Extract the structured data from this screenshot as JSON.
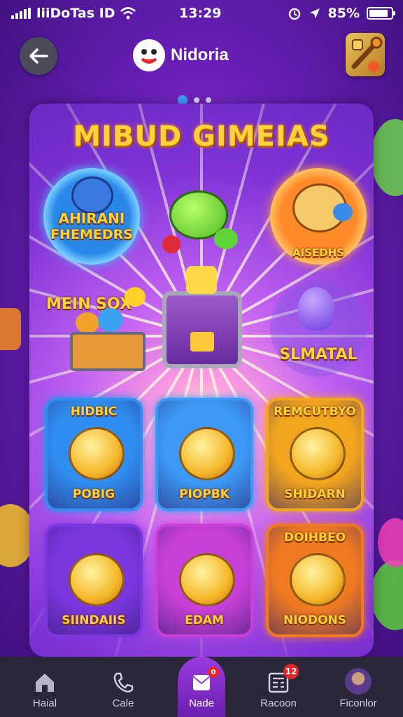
{
  "status_bar": {
    "carrier": "liiDoTas ID",
    "time": "13:29",
    "battery_percent": "85%",
    "battery_level": 0.85
  },
  "header": {
    "back_icon": "arrow-left-icon",
    "app_title": "Nidoria",
    "menu_icon": "toolbox-icon"
  },
  "carousel": {
    "page_count": 3,
    "active_index": 0
  },
  "card": {
    "title": "MIBUD GIMEIAS",
    "round_items": [
      {
        "label": "AHIRANI FHEMEDRS",
        "line1": "AHIRANI",
        "line2": "FHEMEDRS"
      },
      {
        "label": "AISEDHS"
      },
      {
        "label": "MEIN SOX"
      },
      {
        "label": "SLMATAL"
      }
    ],
    "tiles": [
      {
        "label": "POBIG",
        "top_label": "HIDBIC",
        "color": "#2f8ef0"
      },
      {
        "label": "PIOPBK",
        "top_label": "",
        "color": "#3c9af5"
      },
      {
        "label": "SHIDARN",
        "top_label": "REMCUTBYO",
        "color": "#f2a51e"
      },
      {
        "label": "SIINDAIIS",
        "top_label": "",
        "color": "#7c36e0"
      },
      {
        "label": "EDAM",
        "top_label": "",
        "color": "#c840d8"
      },
      {
        "label": "NIODONS",
        "top_label": "DOIHBEO",
        "color": "#f07a22"
      }
    ]
  },
  "bottom_nav": {
    "items": [
      {
        "label": "Haial",
        "icon": "home-icon"
      },
      {
        "label": "Cale",
        "icon": "phone-icon"
      },
      {
        "label": "Nade",
        "icon": "envelope-icon",
        "badge": "0"
      },
      {
        "label": "Racoon",
        "icon": "calculator-icon",
        "badge": "12"
      },
      {
        "label": "Ficonlor",
        "icon": "avatar-icon"
      }
    ],
    "active_index": 2
  },
  "colors": {
    "accent": "#ffd23a",
    "active_nav": "#8a2fd4",
    "background": "#6a1fb8"
  }
}
